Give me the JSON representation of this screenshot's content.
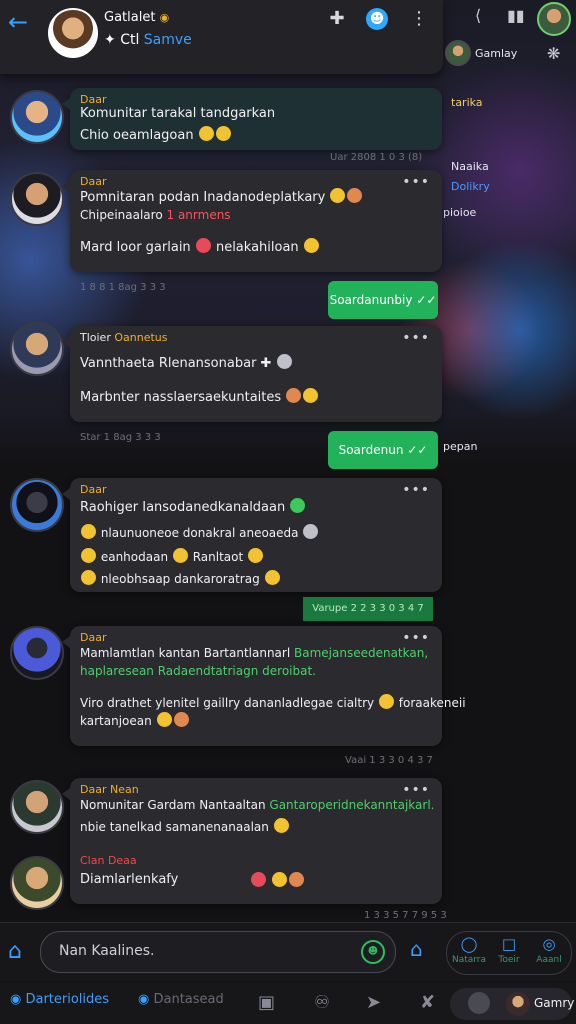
{
  "header": {
    "name": "Gatlalet",
    "status_prefix": "Ctl",
    "status_highlight": "Samve"
  },
  "right_panel": {
    "label": "Gamlay",
    "tag1": "tarika",
    "item1": "Naaika",
    "item2": "Dolikry",
    "item3": "pioioe",
    "item4": "pepan"
  },
  "messages": [
    {
      "author": "Daar",
      "line1": "Komunitar tarakal tandgarkan",
      "line2": "Chio oeamlagoan",
      "time": "Uar 2808 1 0 3 (8)"
    },
    {
      "author": "Daar",
      "line1": "Pomnitaran podan Inadanodeplatkary",
      "line2_prefix": "Chipeinaalaro",
      "line2_red": "1 anrmens",
      "line3_a": "Mard loor garlain",
      "line3_b": "nelakahiloan",
      "time": "1 8 8 1 8ag 3 3 3",
      "sent": "Soardanunbiy"
    },
    {
      "author": "Tloier",
      "tag": "Oannetus",
      "line1": "Vannthaeta Rlenansonabar",
      "line2": "Marbnter nasslaersaekuntaites",
      "time": "Star 1 8ag 3 3 3",
      "sent": "Soardenun"
    },
    {
      "author": "Daar",
      "line1": "Raohiger Iansodanedkanaldaan",
      "line2": "nlaunuoneoe donakral aneoaeda",
      "line3_a": "eanhodaan",
      "line3_b": "Ranltaot",
      "line4": "nleobhsaap dankaroratrag",
      "time": "Varupe 2 2 3 3 0 3 4 7"
    },
    {
      "author": "Daar",
      "line1_a": "Mamlamtlan kantan Bartantlannarl",
      "line1_hl": "Bamejanseedenatkan,",
      "line2_hl": "haplaresean Radaendtatriagn deroibat.",
      "line3_a": "Viro drathet ylenitel gaillry dananladlegae cialtry",
      "line3_b": "foraakeneii",
      "line4": "kartanjoean",
      "time": "Vaai 1 3 3 0 4 3 7"
    },
    {
      "author": "Daar Nean",
      "line1_a": "Nomunitar Gardam Nantaaltan",
      "line1_hl": "Gantaroperidnekanntajkarl.",
      "line2": "nbie tanelkad samanenanaalan",
      "author2": "Clan Deaa",
      "line3": "Diamlarlenkafy",
      "time": "1 3 3 5 7 7 9 5 3"
    }
  ],
  "input": {
    "placeholder": "Nan Kaalines."
  },
  "quick_actions": [
    "Natarra",
    "Toeir",
    "Aaanl"
  ],
  "nav": {
    "item1": "Darteriolides",
    "item2": "Dantasead",
    "me": "Gamry"
  }
}
